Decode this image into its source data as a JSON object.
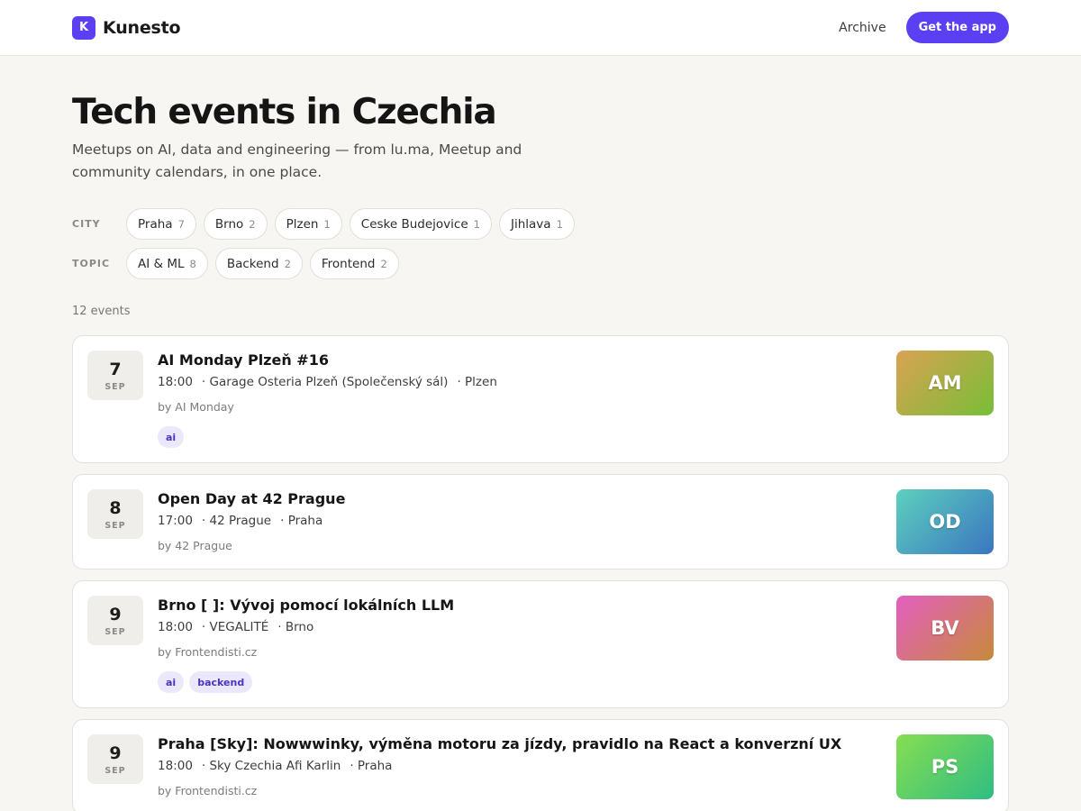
{
  "header": {
    "logo_letter": "K",
    "brand": "Kunesto",
    "nav_archive": "Archive",
    "cta": "Get the app"
  },
  "hero": {
    "title": "Tech events in Czechia",
    "subtitle": "Meetups on AI, data and engineering — from lu.ma, Meetup and community calendars, in one place."
  },
  "filters": {
    "city_label": "CITY",
    "cities": [
      {
        "label": "Praha",
        "count": "7"
      },
      {
        "label": "Brno",
        "count": "2"
      },
      {
        "label": "Plzen",
        "count": "1"
      },
      {
        "label": "Ceske Budejovice",
        "count": "1"
      },
      {
        "label": "Jihlava",
        "count": "1"
      }
    ],
    "topic_label": "TOPIC",
    "topics": [
      {
        "label": "AI & ML",
        "count": "8"
      },
      {
        "label": "Backend",
        "count": "2"
      },
      {
        "label": "Frontend",
        "count": "2"
      }
    ]
  },
  "events_count": "12 events",
  "events": [
    {
      "day": "7",
      "month": "SEP",
      "title": "AI Monday Plzeň #16",
      "time": "18:00",
      "venue": "· Garage Osteria Plzeň (Společenský sál)",
      "city": "· Plzen",
      "by": "by AI Monday",
      "tags": [
        "ai"
      ],
      "thumb": "AM"
    },
    {
      "day": "8",
      "month": "SEP",
      "title": "Open Day at 42 Prague",
      "time": "17:00",
      "venue": "· 42 Prague",
      "city": "· Praha",
      "by": "by 42 Prague",
      "tags": [],
      "thumb": "OD"
    },
    {
      "day": "9",
      "month": "SEP",
      "title": "Brno [   ]: Vývoj pomocí lokálních LLM",
      "time": "18:00",
      "venue": "· VEGALITÉ",
      "city": "· Brno",
      "by": "by Frontendisti.cz",
      "tags": [
        "ai",
        "backend"
      ],
      "thumb": "BV"
    },
    {
      "day": "9",
      "month": "SEP",
      "title": "Praha [Sky]: Nowwwinky, výměna motoru za jízdy, pravidlo na React a konverzní UX",
      "time": "18:00",
      "venue": "· Sky Czechia Afi Karlin",
      "city": "· Praha",
      "by": "by Frontendisti.cz",
      "tags": [],
      "thumb": "PS"
    }
  ]
}
